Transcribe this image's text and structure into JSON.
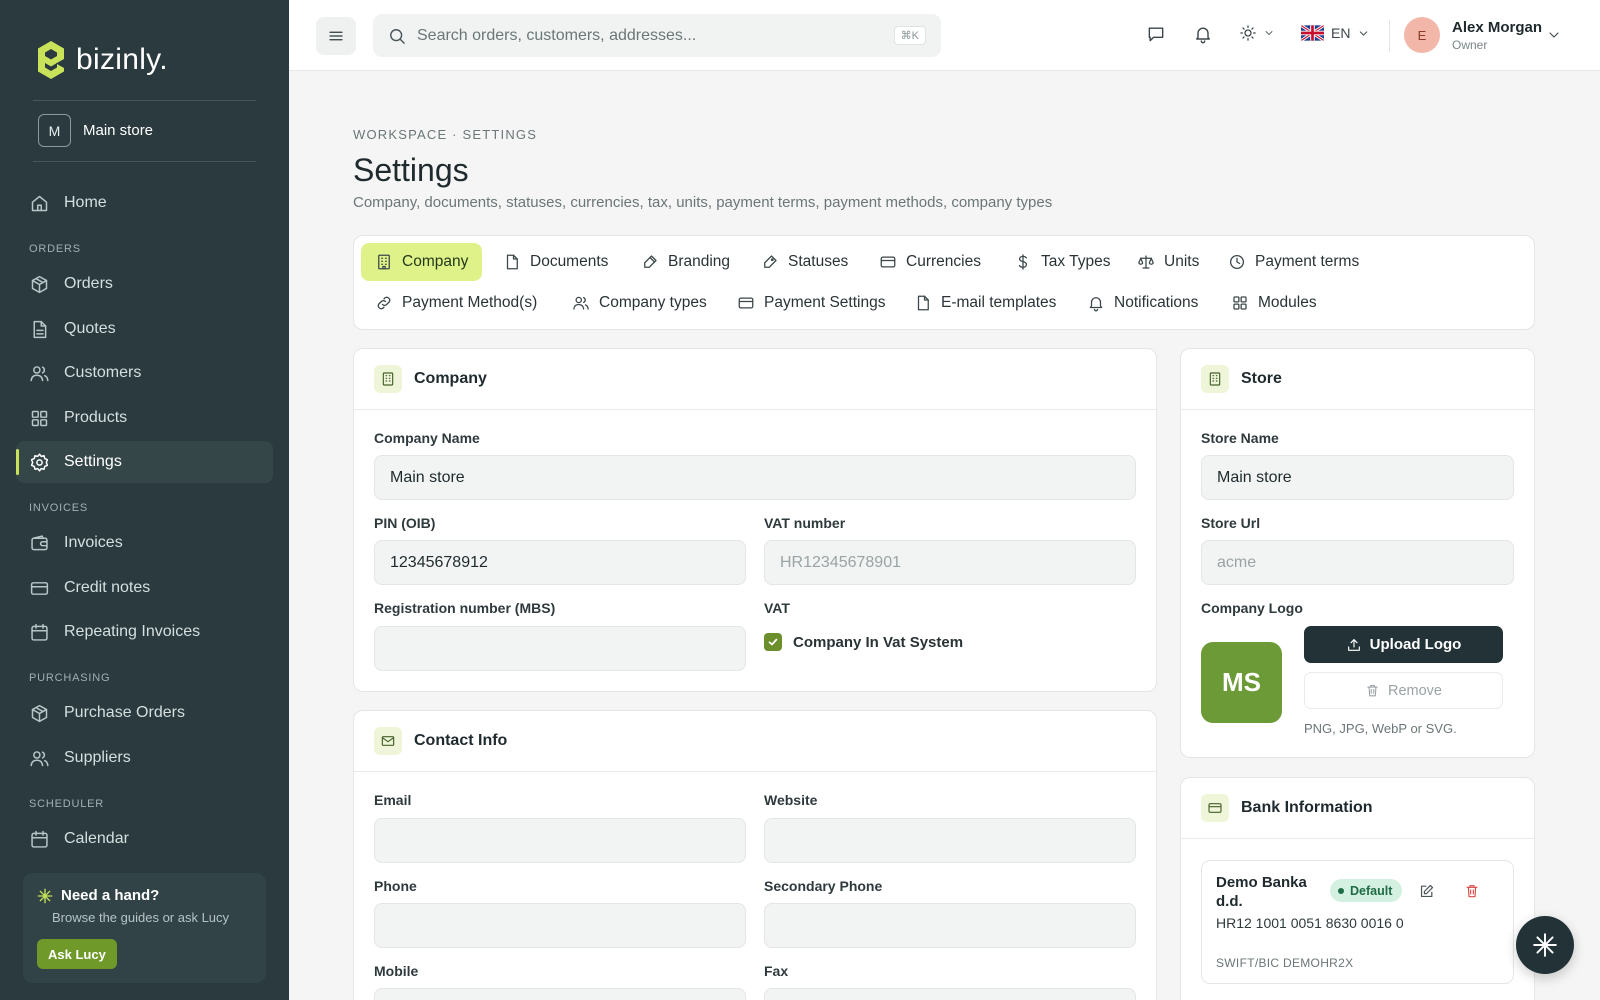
{
  "brand": {
    "name": "bizinly.",
    "accent": "#c8e35a"
  },
  "store_switcher": {
    "initial": "M",
    "name": "Main store"
  },
  "nav": {
    "home": {
      "label": "Home",
      "icon": "home-icon"
    },
    "sections": {
      "orders": "ORDERS",
      "invoices": "INVOICES",
      "purchasing": "PURCHASING",
      "scheduler": "SCHEDULER"
    },
    "items": {
      "orders": "Orders",
      "quotes": "Quotes",
      "customers": "Customers",
      "products": "Products",
      "settings": "Settings",
      "invoices": "Invoices",
      "credit_notes": "Credit notes",
      "repeating_invoices": "Repeating Invoices",
      "purchase_orders": "Purchase Orders",
      "suppliers": "Suppliers",
      "calendar": "Calendar"
    },
    "active": "settings"
  },
  "help": {
    "title": "Need a hand?",
    "subtitle": "Browse the guides or ask Lucy",
    "button": "Ask Lucy"
  },
  "topbar": {
    "search_placeholder": "Search orders, customers, addresses...",
    "search_shortcut": "⌘K",
    "language": "EN",
    "user": {
      "initial": "E",
      "name": "Alex Morgan",
      "role": "Owner"
    }
  },
  "page": {
    "breadcrumb": "WORKSPACE · SETTINGS",
    "title": "Settings",
    "subtitle": "Company, documents, statuses, currencies, tax, units, payment terms, payment methods, company types"
  },
  "tabs": {
    "company": "Company",
    "documents": "Documents",
    "branding": "Branding",
    "statuses": "Statuses",
    "currencies": "Currencies",
    "tax_types": "Tax Types",
    "units": "Units",
    "payment_terms": "Payment terms",
    "payment_methods": "Payment Method(s)",
    "company_types": "Company types",
    "payment_settings": "Payment Settings",
    "email_templates": "E-mail templates",
    "notifications": "Notifications",
    "modules": "Modules",
    "active": "company"
  },
  "company_card": {
    "title": "Company",
    "company_name": {
      "label": "Company Name",
      "value": "Main store"
    },
    "pin": {
      "label": "PIN (OIB)",
      "value": "12345678912"
    },
    "vat_number": {
      "label": "VAT number",
      "placeholder": "HR12345678901"
    },
    "registration": {
      "label": "Registration number (MBS)",
      "value": ""
    },
    "vat": {
      "label": "VAT",
      "checkbox_label": "Company In Vat System",
      "checked": true
    }
  },
  "contact_card": {
    "title": "Contact Info",
    "email": {
      "label": "Email",
      "value": ""
    },
    "website": {
      "label": "Website",
      "value": ""
    },
    "phone": {
      "label": "Phone",
      "value": ""
    },
    "secondary_phone": {
      "label": "Secondary Phone",
      "value": ""
    },
    "mobile": {
      "label": "Mobile",
      "value": ""
    },
    "fax": {
      "label": "Fax",
      "value": ""
    }
  },
  "store_card": {
    "title": "Store",
    "store_name": {
      "label": "Store Name",
      "value": "Main store"
    },
    "store_url": {
      "label": "Store Url",
      "placeholder": "acme"
    },
    "logo": {
      "label": "Company Logo",
      "initials": "MS",
      "upload_label": "Upload Logo",
      "remove_label": "Remove",
      "hint": "PNG, JPG, WebP or SVG."
    }
  },
  "bank_card": {
    "title": "Bank Information",
    "accounts": [
      {
        "name": "Demo Banka d.d.",
        "badge": "Default",
        "iban": "HR12 1001 0051 8630 0016 0",
        "swift": "SWIFT/BIC DEMOHR2X"
      }
    ]
  }
}
